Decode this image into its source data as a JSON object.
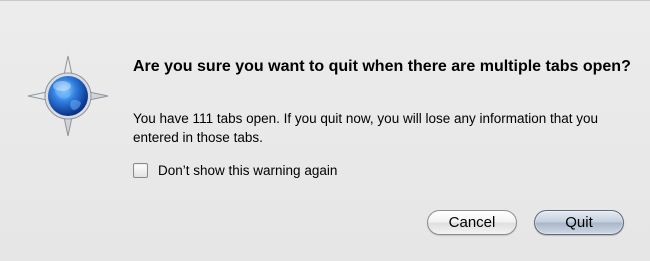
{
  "dialog": {
    "title": "Are you sure you want to quit when there are multiple tabs open?",
    "message": "You have 111 tabs open. If you quit now, you will lose any information that you entered in those tabs.",
    "checkbox_label": "Don’t show this warning again",
    "checkbox_checked": false,
    "cancel_label": "Cancel",
    "quit_label": "Quit",
    "icon": "compass-icon"
  }
}
